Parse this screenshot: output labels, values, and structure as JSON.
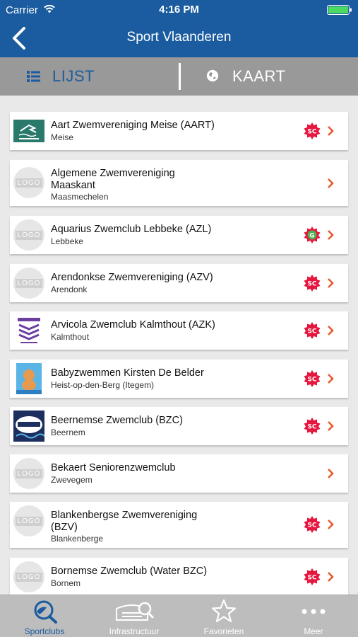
{
  "status_bar": {
    "carrier": "Carrier",
    "time": "4:16 PM",
    "wifi_icon": "wifi-icon",
    "battery_icon": "battery-icon",
    "battery_color": "#4cd964"
  },
  "nav": {
    "title": "Sport Vlaanderen",
    "back_icon": "chevron-left-icon"
  },
  "segments": {
    "list_label": "LIJST",
    "map_label": "KAART",
    "active": "LIJST",
    "active_color": "#1a5c9f"
  },
  "clubs": [
    {
      "name": "Aart Zwemvereniging Meise (AART)",
      "city": "Meise",
      "logo": "aart-logo",
      "badge": "SC"
    },
    {
      "name": "Algemene Zwemvereniging Maaskant",
      "city": "Maasmechelen",
      "logo": "placeholder",
      "badge": ""
    },
    {
      "name": "Aquarius Zwemclub Lebbeke (AZL)",
      "city": "Lebbeke",
      "logo": "placeholder",
      "badge": "G"
    },
    {
      "name": "Arendonkse Zwemvereniging (AZV)",
      "city": "Arendonk",
      "logo": "placeholder",
      "badge": "SC"
    },
    {
      "name": "Arvicola Zwemclub Kalmthout (AZK)",
      "city": "Kalmthout",
      "logo": "azk-logo",
      "badge": "SC"
    },
    {
      "name": "Babyzwemmen Kirsten De Belder",
      "city": "Heist-op-den-Berg (Itegem)",
      "logo": "baby-logo",
      "badge": "SC"
    },
    {
      "name": "Beernemse Zwemclub (BZC)",
      "city": "Beernem",
      "logo": "bzc-logo",
      "badge": "SC"
    },
    {
      "name": "Bekaert Seniorenzwemclub",
      "city": "Zwevegem",
      "logo": "placeholder",
      "badge": ""
    },
    {
      "name": "Blankenbergse Zwemvereniging (BZV)",
      "city": "Blankenberge",
      "logo": "placeholder",
      "badge": "SC"
    },
    {
      "name": "Bornemse Zwemclub (Water BZC)",
      "city": "Bornem",
      "logo": "placeholder",
      "badge": "SC"
    }
  ],
  "logo_placeholder_text": "LOGO",
  "tabs": [
    {
      "label": "Sportclubs",
      "icon": "sportclubs-icon",
      "active": true
    },
    {
      "label": "Infrastructuur",
      "icon": "infrastructure-icon",
      "active": false
    },
    {
      "label": "Favorieten",
      "icon": "star-icon",
      "active": false
    },
    {
      "label": "Meer",
      "icon": "more-icon",
      "active": false
    }
  ],
  "colors": {
    "primary": "#1a5c9f",
    "chevron": "#e8582a",
    "badge_sc": "#e5173f",
    "badge_g": "#4caf50"
  }
}
